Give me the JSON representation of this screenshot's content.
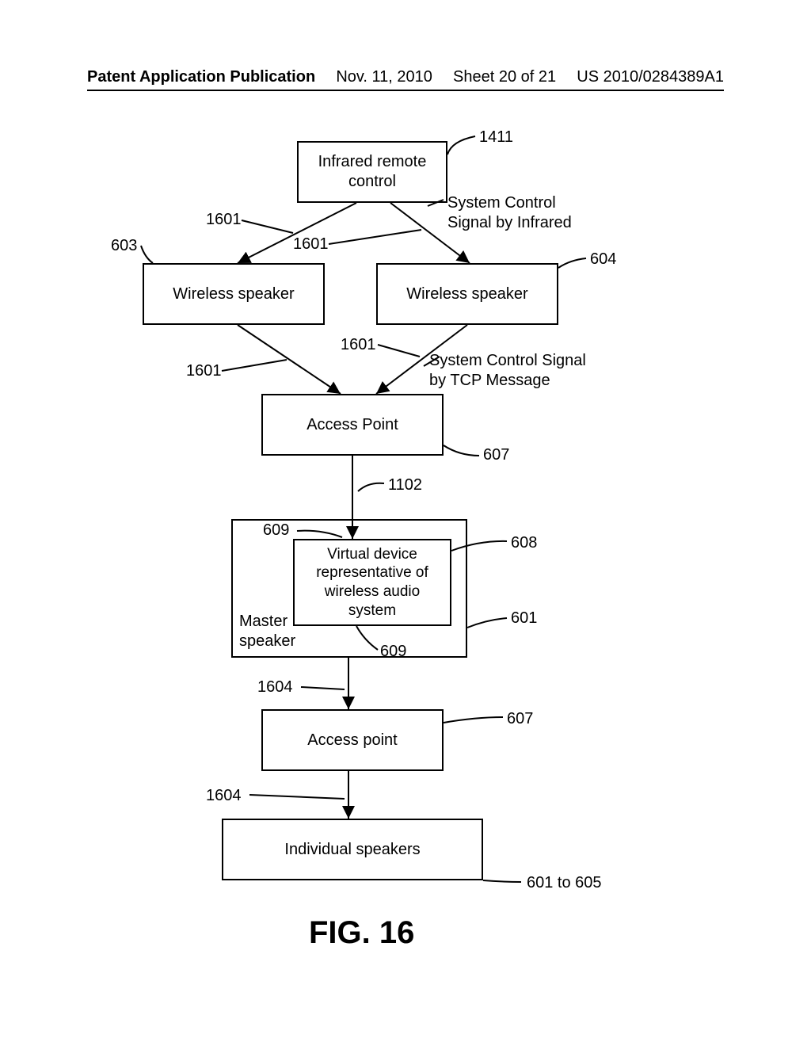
{
  "header": {
    "publication": "Patent Application Publication",
    "date": "Nov. 11, 2010",
    "sheet": "Sheet 20 of 21",
    "docnum": "US 2010/0284389A1"
  },
  "boxes": {
    "remote": "Infrared remote\ncontrol",
    "speaker_left": "Wireless speaker",
    "speaker_right": "Wireless speaker",
    "access_point_1": "Access Point",
    "virtual_device": "Virtual device\nrepresentative of\nwireless audio\nsystem",
    "master_speaker": "Master\nspeaker",
    "access_point_2": "Access point",
    "individual_speakers": "Individual speakers"
  },
  "labels": {
    "n1411": "1411",
    "n1601_a": "1601",
    "n1601_b": "1601",
    "n1601_c": "1601",
    "n1601_d": "1601",
    "n603": "603",
    "n604": "604",
    "sys_ir": "System Control\nSignal by Infrared",
    "sys_tcp": "System Control Signal\nby TCP Message",
    "n607_a": "607",
    "n607_b": "607",
    "n1102": "1102",
    "n609_a": "609",
    "n609_b": "609",
    "n608": "608",
    "n601": "601",
    "n1604_a": "1604",
    "n1604_b": "1604",
    "n601_605": "601 to 605"
  },
  "figure_caption": "FIG. 16"
}
